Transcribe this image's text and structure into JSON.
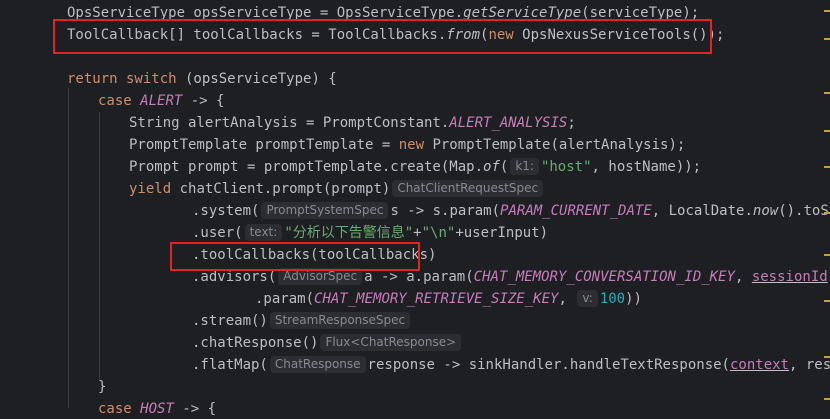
{
  "code": {
    "l0": {
      "a": "OpsServiceType opsServiceType = OpsServiceType.",
      "b": "getServiceType",
      "c": "(serviceType);"
    },
    "l1": {
      "a": "ToolCallback[] toolCallbacks = ToolCallbacks.",
      "b": "from",
      "c": "(",
      "d": "new",
      "e": " OpsNexusServiceTools());"
    },
    "l3": {
      "a": "return switch",
      "b": " (opsServiceType) {"
    },
    "l4": {
      "a": "case",
      "b": " ",
      "c": "ALERT",
      "d": " -> {"
    },
    "l5": {
      "a": "String alertAnalysis = PromptConstant.",
      "b": "ALERT_ANALYSIS",
      "c": ";"
    },
    "l6": {
      "a": "PromptTemplate promptTemplate = ",
      "b": "new",
      "c": " PromptTemplate(alertAnalysis);"
    },
    "l7": {
      "a": "Prompt prompt = promptTemplate.create(Map.",
      "b": "of",
      "c": "(",
      "hint": "k1:",
      "d": "\"host\"",
      "e": ", hostName));"
    },
    "l8": {
      "a": "yield",
      "b": " chatClient.prompt(prompt)",
      "hint": "ChatClientRequestSpec"
    },
    "l9": {
      "a": ".system(",
      "hint": "PromptSystemSpec",
      "b": "s -> s.param(",
      "c": "PARAM_CURRENT_DATE",
      "d": ", LocalDate.",
      "e": "now",
      "f": "().toStr"
    },
    "l10": {
      "a": ".user(",
      "hint": "text:",
      "b": "\"分析以下告警信息\"",
      "c": "+",
      "d": "\"\\n\"",
      "e": "+userInput)"
    },
    "l11": {
      "a": ".toolCallbacks(toolCallbacks)"
    },
    "l12": {
      "a": ".advisors(",
      "hint": "AdvisorSpec",
      "b": "a -> a.param(",
      "c": "CHAT_MEMORY_CONVERSATION_ID_KEY",
      "d": ", ",
      "e": "sessionId",
      "f": ")"
    },
    "l13": {
      "a": ".param(",
      "b": "CHAT_MEMORY_RETRIEVE_SIZE_KEY",
      "c": ", ",
      "hint": "v:",
      "d": "100",
      "e": "))"
    },
    "l14": {
      "a": ".stream()",
      "hint": "StreamResponseSpec"
    },
    "l15": {
      "a": ".chatResponse()",
      "hint": "Flux<ChatResponse>"
    },
    "l16": {
      "a": ".flatMap(",
      "hint": "ChatResponse",
      "b": "response -> sinkHandler.handleTextResponse(",
      "c": "context",
      "d": ", respo"
    },
    "l17": {
      "a": "}"
    },
    "l18": {
      "a": "case",
      "b": " ",
      "c": "HOST",
      "d": " -> {"
    }
  },
  "colors": {
    "background": "#1e1f22",
    "highlight_box": "#e02424",
    "keyword": "#cf8e6d",
    "string": "#6aab73",
    "constant": "#c77dbb",
    "number": "#2aacb8"
  }
}
